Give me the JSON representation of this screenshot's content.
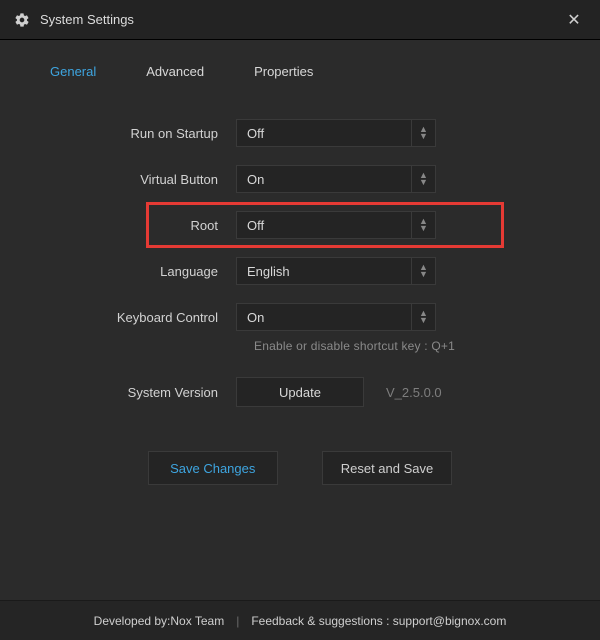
{
  "window": {
    "title": "System Settings"
  },
  "tabs": {
    "general": "General",
    "advanced": "Advanced",
    "properties": "Properties"
  },
  "settings": {
    "run_on_startup": {
      "label": "Run on Startup",
      "value": "Off"
    },
    "virtual_button": {
      "label": "Virtual Button",
      "value": "On"
    },
    "root": {
      "label": "Root",
      "value": "Off"
    },
    "language": {
      "label": "Language",
      "value": "English"
    },
    "keyboard_control": {
      "label": "Keyboard Control",
      "value": "On",
      "hint": "Enable or disable shortcut key : Q+1"
    },
    "system_version": {
      "label": "System Version",
      "update_btn": "Update",
      "version": "V_2.5.0.0"
    }
  },
  "actions": {
    "save_changes": "Save Changes",
    "reset_and_save": "Reset and Save"
  },
  "footer": {
    "developed_by": "Developed by:Nox Team",
    "feedback": "Feedback & suggestions : support@bignox.com"
  }
}
